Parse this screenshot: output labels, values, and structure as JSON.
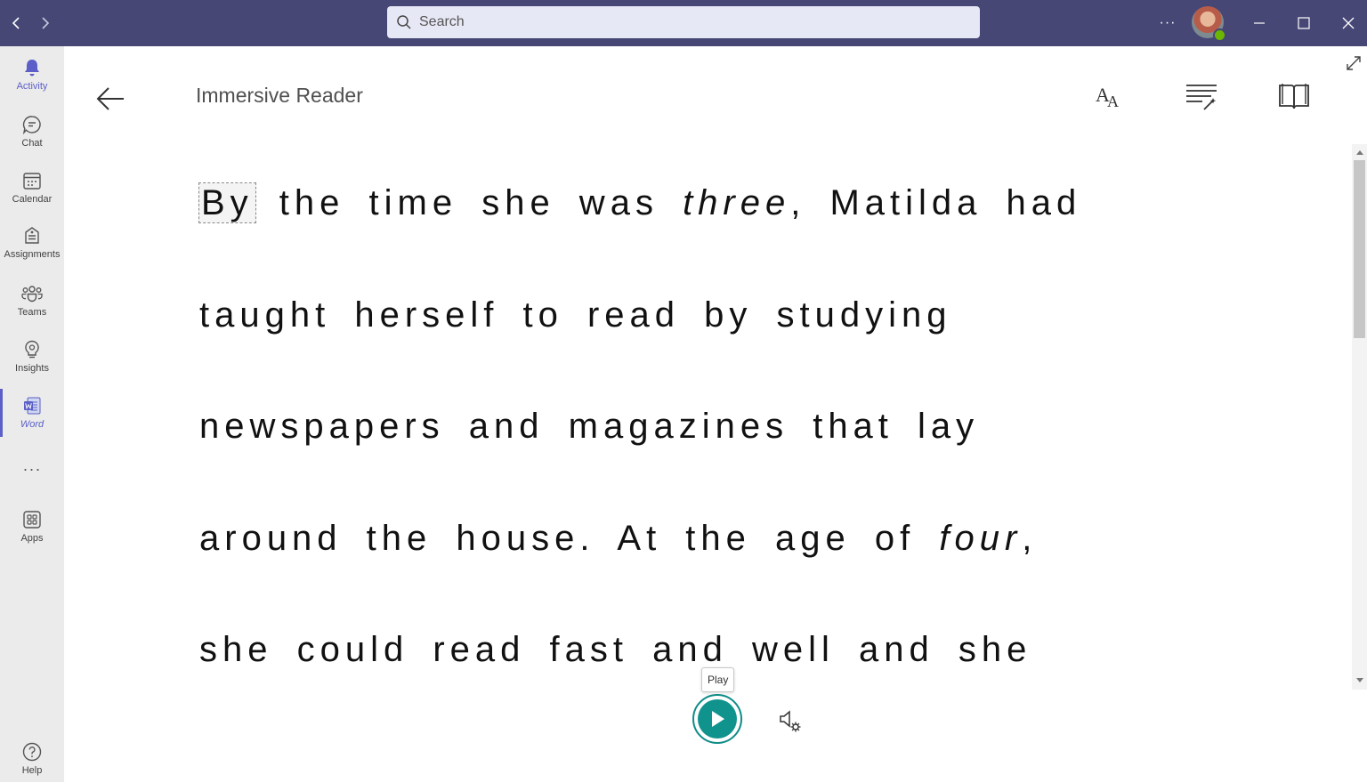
{
  "titlebar": {
    "search_placeholder": "Search",
    "more_label": "···",
    "colors": {
      "background": "#464775",
      "search_bg": "#e7e8f5"
    }
  },
  "rail": {
    "items": [
      {
        "label": "Activity",
        "icon": "bell-icon"
      },
      {
        "label": "Chat",
        "icon": "chat-icon"
      },
      {
        "label": "Calendar",
        "icon": "calendar-icon"
      },
      {
        "label": "Assignments",
        "icon": "assignments-icon"
      },
      {
        "label": "Teams",
        "icon": "teams-icon"
      },
      {
        "label": "Insights",
        "icon": "lightbulb-icon"
      },
      {
        "label": "Word",
        "icon": "word-icon"
      },
      {
        "label": "Apps",
        "icon": "apps-icon"
      },
      {
        "label": "Help",
        "icon": "help-icon"
      }
    ],
    "more_label": "···",
    "accent_color": "#5b5fc7"
  },
  "reader": {
    "title": "Immersive Reader",
    "lines": [
      {
        "first_word": "By",
        "rest_1": " the time she was ",
        "italic": "three",
        "rest_2": ", Matilda had"
      },
      {
        "text": "taught herself to read by studying"
      },
      {
        "text": "newspapers and magazines that lay"
      },
      {
        "rest_1": "around the house. At the age of ",
        "italic": "four",
        "rest_2": ","
      },
      {
        "text": "she could read fast and well and she"
      }
    ],
    "tooltip": "Play",
    "play_color": "#10938d"
  }
}
